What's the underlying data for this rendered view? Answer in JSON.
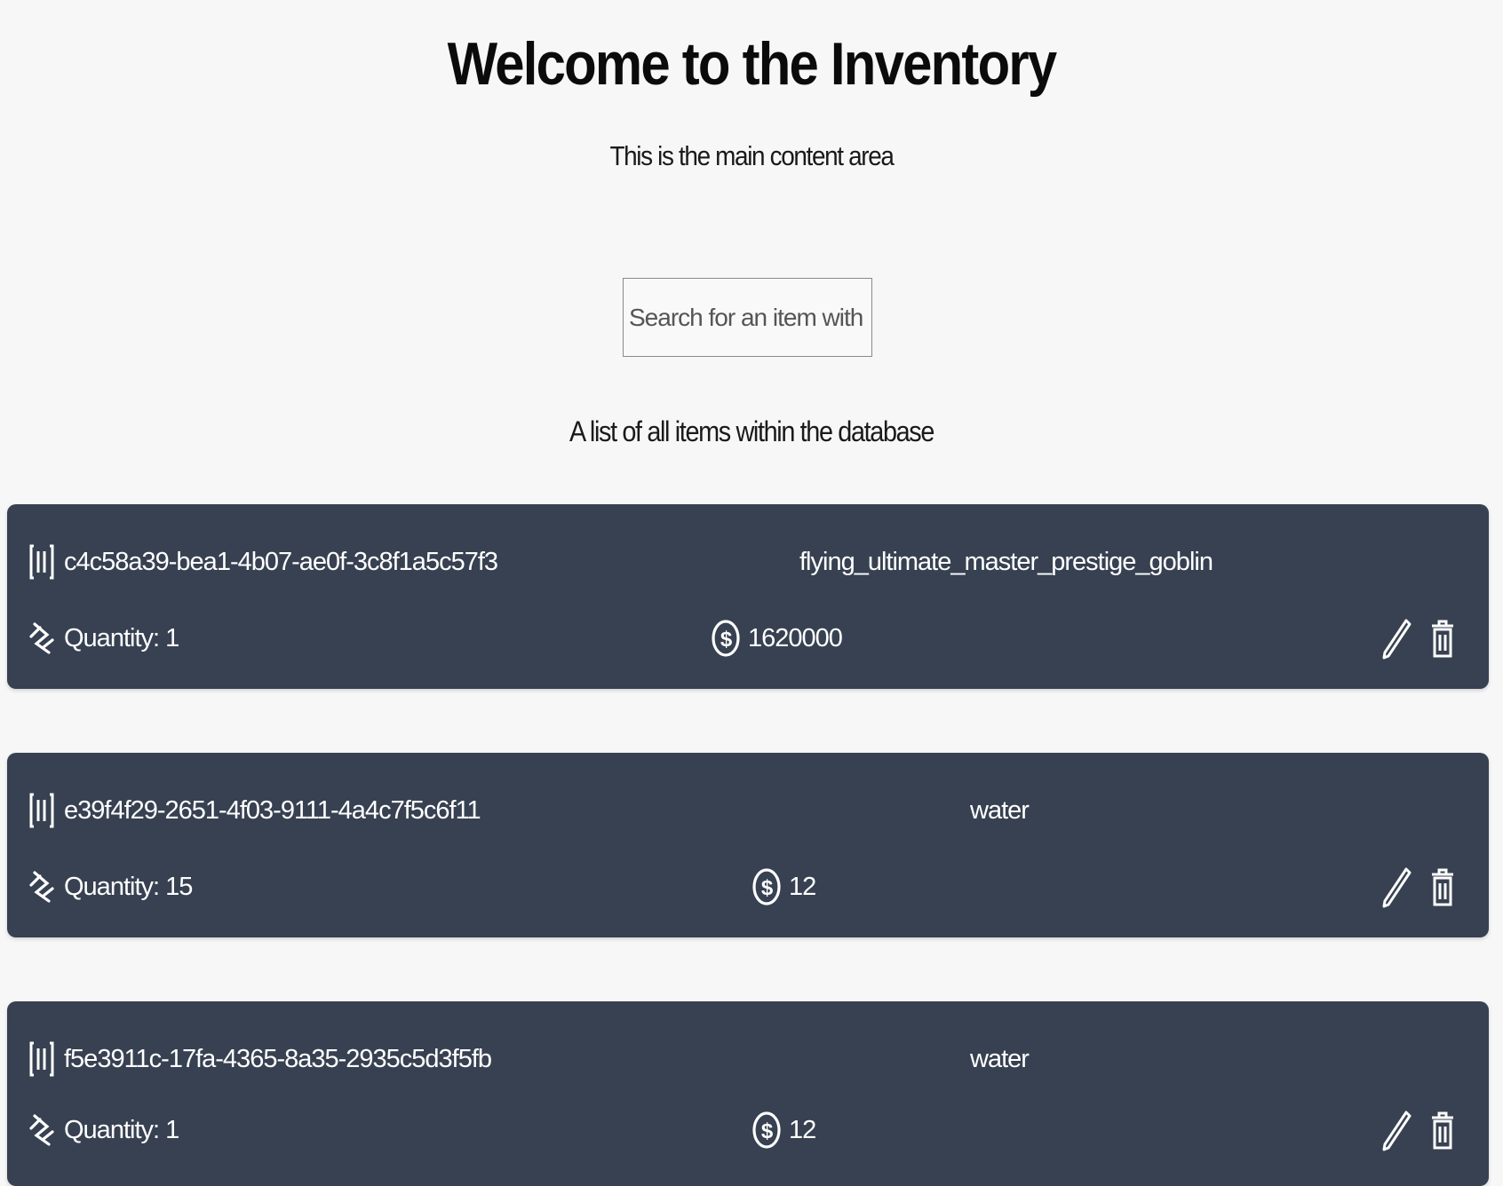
{
  "header": {
    "title": "Welcome to the Inventory",
    "subtitle": "This is the main content area"
  },
  "search": {
    "placeholder": "Search for an item with ID",
    "value": ""
  },
  "list": {
    "caption": "A list of all items within the database",
    "items": [
      {
        "id": "c4c58a39-bea1-4b07-ae0f-3c8f1a5c57f3",
        "name": "flying_ultimate_master_prestige_goblin",
        "quantity_label": "Quantity: 1",
        "price": "1620000"
      },
      {
        "id": "e39f4f29-2651-4f03-9111-4a4c7f5c6f11",
        "name": "water",
        "quantity_label": "Quantity: 15",
        "price": "12"
      },
      {
        "id": "f5e3911c-17fa-4365-8a35-2935c5d3f5fb",
        "name": "water",
        "quantity_label": "Quantity: 1",
        "price": "12"
      }
    ]
  },
  "icons": {
    "id": "id-card-icon",
    "quantity": "quantity-icon",
    "price": "dollar-icon",
    "edit": "pencil-icon",
    "delete": "trash-icon"
  },
  "colors": {
    "card_background": "#374151",
    "page_background": "#f7f7f8",
    "card_text": "#ffffff"
  }
}
